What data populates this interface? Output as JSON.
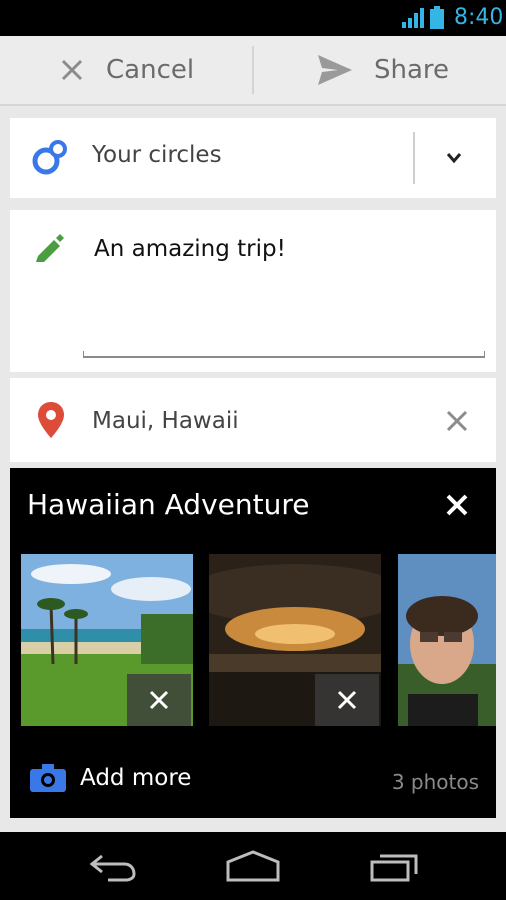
{
  "status_bar": {
    "time": "8:40",
    "signal_icon": "signal-icon",
    "battery_icon": "battery-icon",
    "accent": "#33b5e5"
  },
  "action_bar": {
    "cancel_label": "Cancel",
    "share_label": "Share",
    "cancel_icon": "close-icon",
    "share_icon": "send-icon"
  },
  "audience": {
    "label": "Your circles",
    "icon": "circles-icon",
    "dropdown_icon": "chevron-down-icon"
  },
  "post": {
    "text": "An amazing trip!",
    "icon": "pencil-icon"
  },
  "location": {
    "label": "Maui, Hawaii",
    "icon": "location-pin-icon",
    "clear_icon": "close-icon"
  },
  "album": {
    "title": "Hawaiian Adventure",
    "photos": [
      {
        "name": "photo-beach"
      },
      {
        "name": "photo-sunset"
      },
      {
        "name": "photo-portrait"
      }
    ],
    "add_more_label": "Add more",
    "photo_count": "3 photos"
  },
  "nav": {
    "back_icon": "back-icon",
    "home_icon": "home-icon",
    "recents_icon": "recent-apps-icon"
  }
}
